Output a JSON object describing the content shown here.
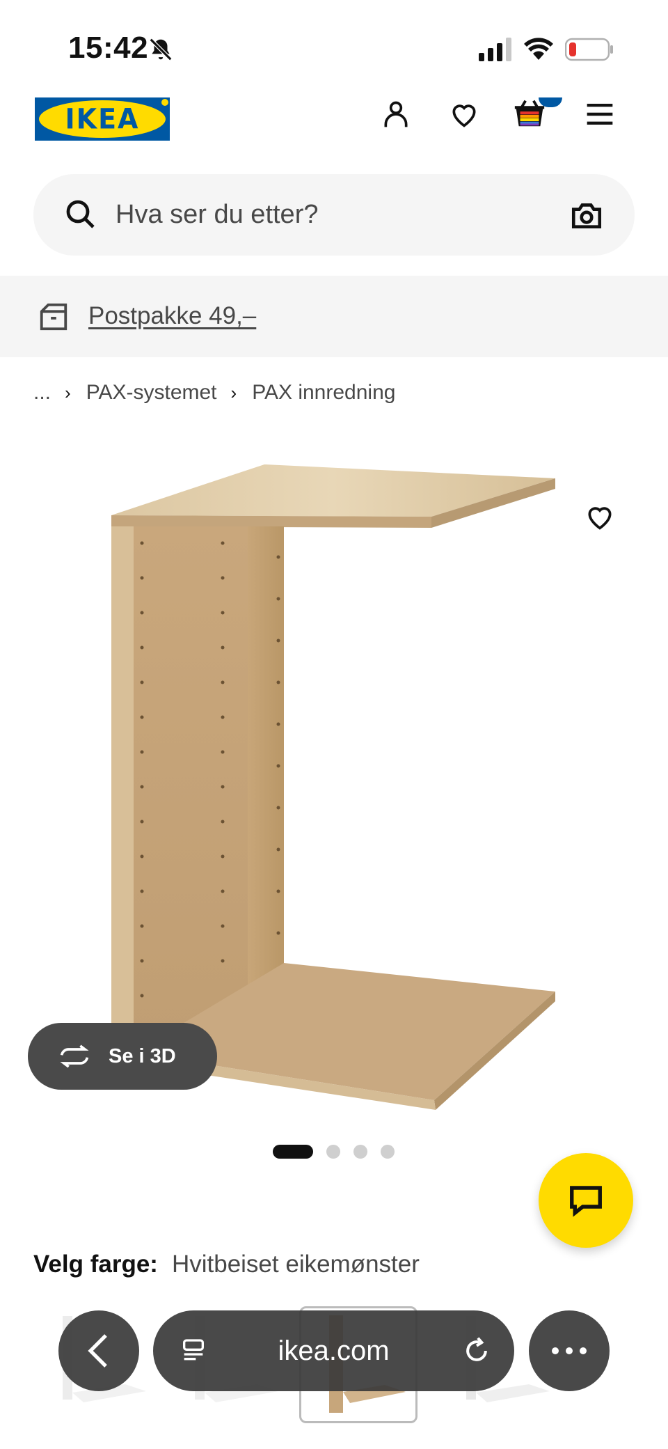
{
  "status_bar": {
    "time": "15:42",
    "icons": [
      "bell-off-icon",
      "signal-icon",
      "wifi-icon",
      "battery-icon"
    ],
    "battery_color": "#e5322d"
  },
  "header": {
    "logo_text": "IKEA",
    "brand_colors": {
      "blue": "#0058a3",
      "yellow": "#ffdb00"
    },
    "icons": [
      "user-icon",
      "heart-icon",
      "basket-icon",
      "menu-icon"
    ]
  },
  "search": {
    "placeholder": "Hva ser du etter?",
    "value": ""
  },
  "delivery_banner": {
    "text": "Postpakke 49,–"
  },
  "breadcrumb": {
    "ellipsis": "...",
    "items": [
      "PAX-systemet",
      "PAX innredning"
    ]
  },
  "product": {
    "view_3d_label": "Se i 3D",
    "carousel": {
      "total": 4,
      "active_index": 0
    }
  },
  "color_select": {
    "label": "Velg farge:",
    "value": "Hvitbeiset eikemønster"
  },
  "browser_bar": {
    "url": "ikea.com"
  }
}
